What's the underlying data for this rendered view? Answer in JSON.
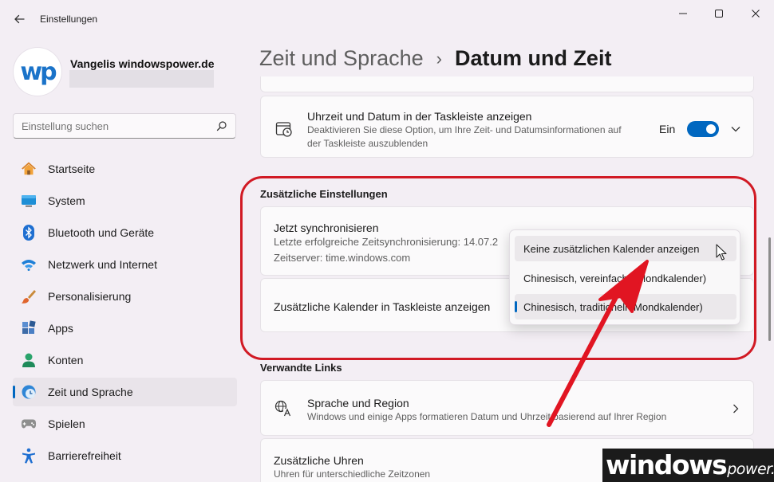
{
  "window": {
    "title": "Einstellungen",
    "controls": [
      "minimize-icon",
      "maximize-icon",
      "close-icon"
    ]
  },
  "profile": {
    "avatar_text": "wp",
    "name": "Vangelis windowspower.de"
  },
  "search": {
    "placeholder": "Einstellung suchen"
  },
  "nav": {
    "items": [
      {
        "label": "Startseite",
        "icon": "home-icon"
      },
      {
        "label": "System",
        "icon": "monitor-icon"
      },
      {
        "label": "Bluetooth und Geräte",
        "icon": "bluetooth-icon"
      },
      {
        "label": "Netzwerk und Internet",
        "icon": "wifi-icon"
      },
      {
        "label": "Personalisierung",
        "icon": "brush-icon"
      },
      {
        "label": "Apps",
        "icon": "apps-icon"
      },
      {
        "label": "Konten",
        "icon": "account-icon"
      },
      {
        "label": "Zeit und Sprache",
        "icon": "clock-globe-icon",
        "active": true
      },
      {
        "label": "Spielen",
        "icon": "gamepad-icon"
      },
      {
        "label": "Barrierefreiheit",
        "icon": "accessibility-icon"
      }
    ]
  },
  "header": {
    "parent": "Zeit und Sprache",
    "separator": "›",
    "current": "Datum und Zeit"
  },
  "taskbar_card": {
    "title": "Uhrzeit und Datum in der Taskleiste anzeigen",
    "desc_line1": "Deaktivieren Sie diese Option, um Ihre Zeit- und Datumsinformationen auf",
    "desc_line2": "der Taskleiste auszublenden",
    "toggle_label": "Ein",
    "toggle_on": true
  },
  "additional": {
    "section_title": "Zusätzliche Einstellungen",
    "sync": {
      "title": "Jetzt synchronisieren",
      "last_sync": "Letzte erfolgreiche Zeitsynchronisierung: 14.07.2",
      "server": "Zeitserver: time.windows.com"
    },
    "calendar": {
      "title": "Zusätzliche Kalender in Taskleiste anzeigen"
    },
    "dropdown": {
      "options": [
        "Keine zusätzlichen Kalender anzeigen",
        "Chinesisch, vereinfacht (Mondkalender)",
        "Chinesisch, traditionell (Mondkalender)"
      ],
      "hovered_index": 0,
      "selected_index": 2
    }
  },
  "related": {
    "section_title": "Verwandte Links",
    "language_region": {
      "title": "Sprache und Region",
      "desc": "Windows und einige Apps formatieren Datum und Uhrzeit basierend auf Ihrer Region"
    },
    "clocks": {
      "title": "Zusätzliche Uhren",
      "desc": "Uhren für unterschiedliche Zeitzonen"
    }
  },
  "watermark": {
    "main": "windows",
    "small": "power."
  },
  "colors": {
    "accent": "#0067c0",
    "annotation": "#d11a24",
    "background": "#f3eef4",
    "card": "#fbfafb"
  }
}
